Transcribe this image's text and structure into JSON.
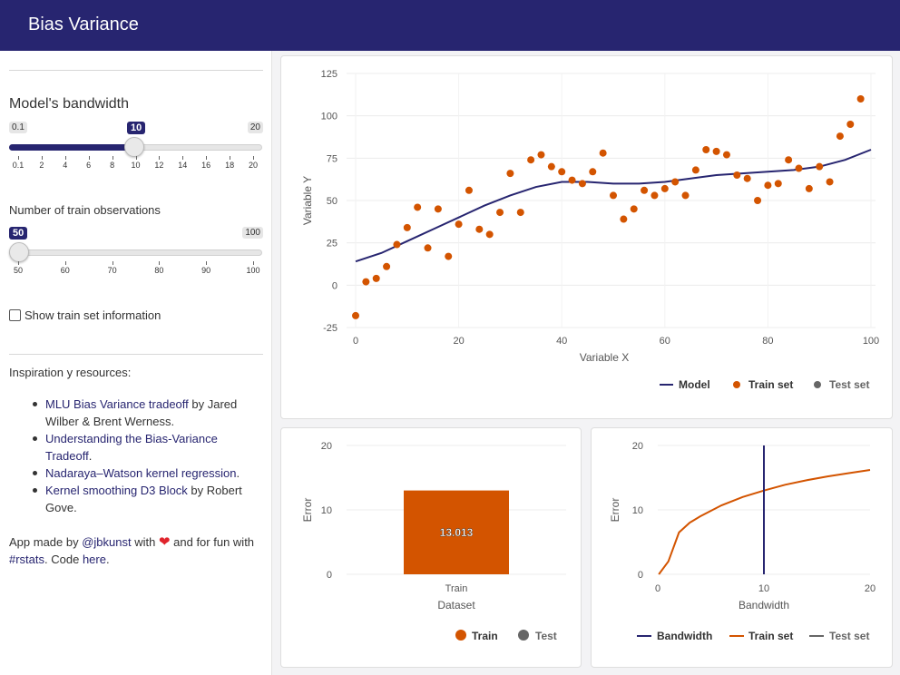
{
  "app": {
    "title": "Bias Variance"
  },
  "sidebar": {
    "bandwidth": {
      "label": "Model's bandwidth",
      "min": "0.1",
      "max": "20",
      "value": "10",
      "ticks": [
        "0.1",
        "2",
        "4",
        "6",
        "8",
        "10",
        "12",
        "14",
        "16",
        "18",
        "20"
      ]
    },
    "train_obs": {
      "label": "Number of train observations",
      "min": "50",
      "max": "100",
      "value": "50",
      "ticks": [
        "50",
        "60",
        "70",
        "80",
        "90",
        "100"
      ]
    },
    "show_train_info": {
      "label": "Show train set information",
      "checked": false
    },
    "resources_title": "Inspiration y resources:",
    "resources": [
      {
        "link": "MLU Bias Variance tradeoff",
        "text": " by Jared Wilber & Brent Werness."
      },
      {
        "link": "Understanding the Bias-Variance Tradeoff",
        "text": "."
      },
      {
        "link": "Nadaraya–Watson kernel regression",
        "text": "."
      },
      {
        "link": "Kernel smoothing D3 Block",
        "text": " by Robert Gove."
      }
    ],
    "credit": {
      "prefix": "App made by ",
      "author": "@jbkunst",
      "middle": " with ",
      "suffix": " and for fun with ",
      "hashtag": "#rstats",
      "code_prefix": ". Code ",
      "code_link": "here",
      "end": "."
    }
  },
  "colors": {
    "navy": "#272570",
    "orange": "#d35400",
    "gray": "#666666",
    "link": "#272570"
  },
  "chart_data": [
    {
      "type": "scatter",
      "xlabel": "Variable X",
      "ylabel": "Variable Y",
      "xlim": [
        0,
        100
      ],
      "ylim": [
        -25,
        125
      ],
      "x_ticks": [
        "0",
        "20",
        "40",
        "60",
        "80",
        "100"
      ],
      "y_ticks": [
        "125",
        "100",
        "75",
        "50",
        "25",
        "0",
        "-25"
      ],
      "legend": [
        "Model",
        "Train set",
        "Test set"
      ],
      "train_points": [
        [
          0,
          -18
        ],
        [
          2,
          2
        ],
        [
          4,
          4
        ],
        [
          6,
          11
        ],
        [
          8,
          24
        ],
        [
          10,
          34
        ],
        [
          12,
          46
        ],
        [
          14,
          22
        ],
        [
          16,
          45
        ],
        [
          18,
          17
        ],
        [
          20,
          36
        ],
        [
          22,
          56
        ],
        [
          24,
          33
        ],
        [
          26,
          30
        ],
        [
          28,
          43
        ],
        [
          30,
          66
        ],
        [
          32,
          43
        ],
        [
          34,
          74
        ],
        [
          36,
          77
        ],
        [
          38,
          70
        ],
        [
          40,
          67
        ],
        [
          42,
          62
        ],
        [
          44,
          60
        ],
        [
          46,
          67
        ],
        [
          48,
          78
        ],
        [
          50,
          53
        ],
        [
          52,
          39
        ],
        [
          54,
          45
        ],
        [
          56,
          56
        ],
        [
          58,
          53
        ],
        [
          60,
          57
        ],
        [
          62,
          61
        ],
        [
          64,
          53
        ],
        [
          66,
          68
        ],
        [
          68,
          80
        ],
        [
          70,
          79
        ],
        [
          72,
          77
        ],
        [
          74,
          65
        ],
        [
          76,
          63
        ],
        [
          78,
          50
        ],
        [
          80,
          59
        ],
        [
          82,
          60
        ],
        [
          84,
          74
        ],
        [
          86,
          69
        ],
        [
          88,
          57
        ],
        [
          90,
          70
        ],
        [
          92,
          61
        ],
        [
          94,
          88
        ],
        [
          96,
          95
        ],
        [
          98,
          110
        ]
      ],
      "model_line": [
        [
          0,
          14
        ],
        [
          5,
          19
        ],
        [
          10,
          26
        ],
        [
          15,
          33
        ],
        [
          20,
          40
        ],
        [
          25,
          47
        ],
        [
          30,
          53
        ],
        [
          35,
          58
        ],
        [
          40,
          61
        ],
        [
          45,
          61
        ],
        [
          50,
          60
        ],
        [
          55,
          60
        ],
        [
          60,
          61
        ],
        [
          65,
          63
        ],
        [
          70,
          65
        ],
        [
          75,
          66
        ],
        [
          80,
          67
        ],
        [
          85,
          68
        ],
        [
          90,
          70
        ],
        [
          95,
          74
        ],
        [
          100,
          80
        ]
      ]
    },
    {
      "type": "bar",
      "xlabel": "Dataset",
      "ylabel": "Error",
      "ylim": [
        0,
        20
      ],
      "y_ticks": [
        "20",
        "10",
        "0"
      ],
      "categories": [
        "Train"
      ],
      "values": [
        13.013
      ],
      "value_label": "13.013",
      "legend": [
        "Train",
        "Test"
      ]
    },
    {
      "type": "line",
      "xlabel": "Bandwidth",
      "ylabel": "Error",
      "xlim": [
        0,
        20
      ],
      "ylim": [
        0,
        20
      ],
      "x_ticks": [
        "0",
        "10",
        "20"
      ],
      "y_ticks": [
        "20",
        "10",
        "0"
      ],
      "bandwidth_marker": 10,
      "legend": [
        "Bandwidth",
        "Train set",
        "Test set"
      ],
      "train_line": [
        [
          0.1,
          0
        ],
        [
          1,
          2
        ],
        [
          2,
          6.5
        ],
        [
          3,
          8
        ],
        [
          4,
          9
        ],
        [
          6,
          10.7
        ],
        [
          8,
          12
        ],
        [
          10,
          13
        ],
        [
          12,
          13.9
        ],
        [
          14,
          14.6
        ],
        [
          16,
          15.2
        ],
        [
          18,
          15.7
        ],
        [
          20,
          16.2
        ]
      ]
    }
  ]
}
